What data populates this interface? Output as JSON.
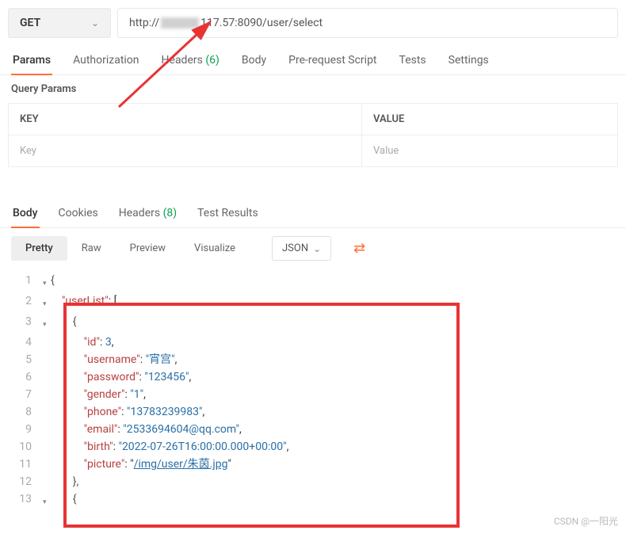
{
  "request": {
    "method": "GET",
    "url_prefix": "http://",
    "url_suffix": "117.57:8090/user/select"
  },
  "reqTabs": {
    "params": "Params",
    "authorization": "Authorization",
    "headers": "Headers",
    "headers_count": "(6)",
    "body": "Body",
    "prereq": "Pre-request Script",
    "tests": "Tests",
    "settings": "Settings"
  },
  "queryParams": {
    "title": "Query Params",
    "keyHeader": "KEY",
    "valueHeader": "VALUE",
    "keyPlaceholder": "Key",
    "valuePlaceholder": "Value"
  },
  "respTabs": {
    "body": "Body",
    "cookies": "Cookies",
    "headers": "Headers",
    "headers_count": "(8)",
    "testResults": "Test Results"
  },
  "viewBar": {
    "pretty": "Pretty",
    "raw": "Raw",
    "preview": "Preview",
    "visualize": "Visualize",
    "format": "JSON"
  },
  "responseBody": {
    "lines": [
      {
        "n": 1,
        "fold": "▾",
        "indent": 0,
        "tokens": [
          {
            "t": "brace",
            "v": "{"
          }
        ]
      },
      {
        "n": 2,
        "fold": "▾",
        "indent": 1,
        "tokens": [
          {
            "t": "key",
            "v": "\"userList\""
          },
          {
            "t": "plain",
            "v": ": ["
          }
        ]
      },
      {
        "n": 3,
        "fold": "▾",
        "indent": 2,
        "tokens": [
          {
            "t": "brace",
            "v": "{"
          }
        ]
      },
      {
        "n": 4,
        "fold": "",
        "indent": 3,
        "tokens": [
          {
            "t": "key",
            "v": "\"id\""
          },
          {
            "t": "plain",
            "v": ": "
          },
          {
            "t": "num",
            "v": "3"
          },
          {
            "t": "plain",
            "v": ","
          }
        ]
      },
      {
        "n": 5,
        "fold": "",
        "indent": 3,
        "tokens": [
          {
            "t": "key",
            "v": "\"username\""
          },
          {
            "t": "plain",
            "v": ": "
          },
          {
            "t": "str",
            "v": "\"宵宫\""
          },
          {
            "t": "plain",
            "v": ","
          }
        ]
      },
      {
        "n": 6,
        "fold": "",
        "indent": 3,
        "tokens": [
          {
            "t": "key",
            "v": "\"password\""
          },
          {
            "t": "plain",
            "v": ": "
          },
          {
            "t": "str",
            "v": "\"123456\""
          },
          {
            "t": "plain",
            "v": ","
          }
        ]
      },
      {
        "n": 7,
        "fold": "",
        "indent": 3,
        "tokens": [
          {
            "t": "key",
            "v": "\"gender\""
          },
          {
            "t": "plain",
            "v": ": "
          },
          {
            "t": "str",
            "v": "\"1\""
          },
          {
            "t": "plain",
            "v": ","
          }
        ]
      },
      {
        "n": 8,
        "fold": "",
        "indent": 3,
        "tokens": [
          {
            "t": "key",
            "v": "\"phone\""
          },
          {
            "t": "plain",
            "v": ": "
          },
          {
            "t": "str",
            "v": "\"13783239983\""
          },
          {
            "t": "plain",
            "v": ","
          }
        ]
      },
      {
        "n": 9,
        "fold": "",
        "indent": 3,
        "tokens": [
          {
            "t": "key",
            "v": "\"email\""
          },
          {
            "t": "plain",
            "v": ": "
          },
          {
            "t": "str",
            "v": "\"2533694604@qq.com\""
          },
          {
            "t": "plain",
            "v": ","
          }
        ]
      },
      {
        "n": 10,
        "fold": "",
        "indent": 3,
        "tokens": [
          {
            "t": "key",
            "v": "\"birth\""
          },
          {
            "t": "plain",
            "v": ": "
          },
          {
            "t": "str",
            "v": "\"2022-07-26T16:00:00.000+00:00\""
          },
          {
            "t": "plain",
            "v": ","
          }
        ]
      },
      {
        "n": 11,
        "fold": "",
        "indent": 3,
        "tokens": [
          {
            "t": "key",
            "v": "\"picture\""
          },
          {
            "t": "plain",
            "v": ": \""
          },
          {
            "t": "link",
            "v": "/img/user/朱茵.jpg"
          },
          {
            "t": "plain",
            "v": "\""
          }
        ]
      },
      {
        "n": 12,
        "fold": "",
        "indent": 2,
        "tokens": [
          {
            "t": "brace",
            "v": "},"
          }
        ]
      },
      {
        "n": 13,
        "fold": "▾",
        "indent": 2,
        "tokens": [
          {
            "t": "brace",
            "v": "{"
          }
        ]
      }
    ]
  },
  "watermark": "CSDN @一阳光"
}
